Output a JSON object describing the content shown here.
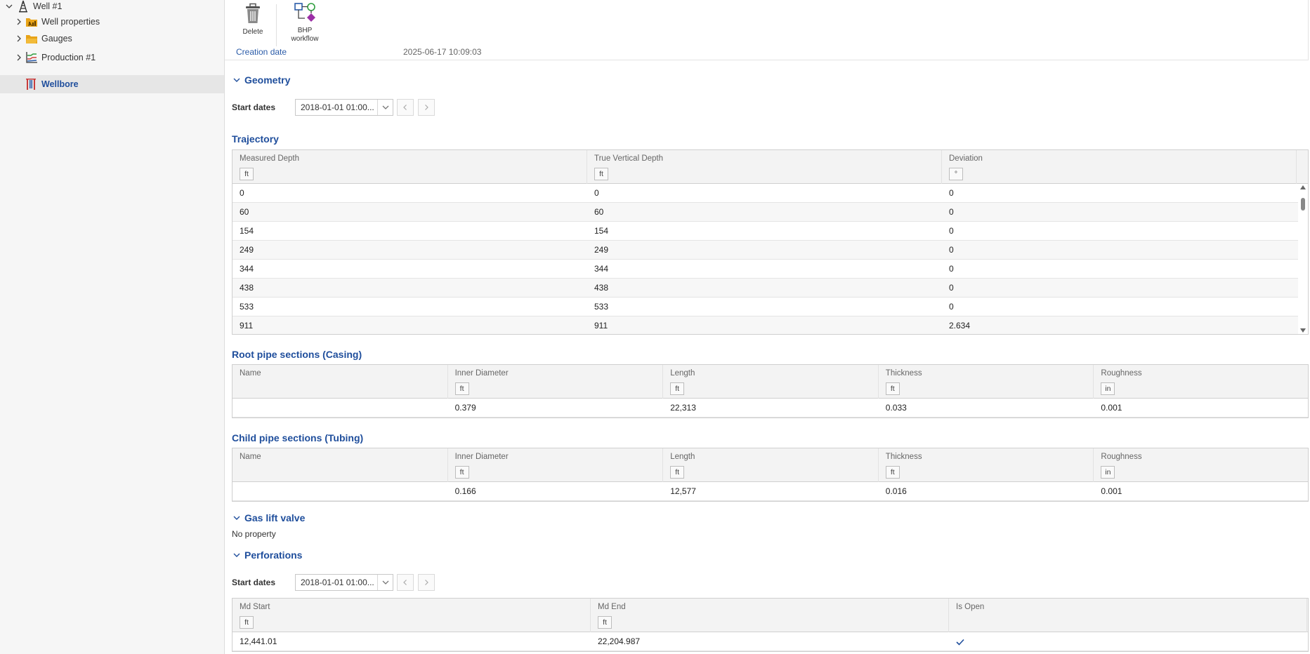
{
  "sidebar": {
    "items": [
      {
        "label": "Well #1",
        "expanded": true,
        "icon": "well-derrick-icon"
      },
      {
        "label": "Well properties",
        "expanded": false,
        "icon": "well-properties-icon"
      },
      {
        "label": "Gauges",
        "expanded": false,
        "icon": "folder-icon"
      },
      {
        "label": "Production #1",
        "expanded": false,
        "icon": "production-chart-icon"
      },
      {
        "label": "Wellbore",
        "selected": true,
        "icon": "wellbore-icon"
      }
    ]
  },
  "toolbar": {
    "delete_label": "Delete",
    "bhp_label_line1": "BHP",
    "bhp_label_line2": "workflow"
  },
  "header": {
    "creation_label": "Creation date",
    "creation_value": "2025-06-17 10:09:03"
  },
  "geometry": {
    "title": "Geometry",
    "start_dates_label": "Start dates",
    "start_date_value": "2018-01-01 01:00..."
  },
  "trajectory": {
    "title": "Trajectory",
    "columns": [
      {
        "label": "Measured Depth",
        "unit": "ft"
      },
      {
        "label": "True Vertical Depth",
        "unit": "ft"
      },
      {
        "label": "Deviation",
        "unit": "°"
      }
    ],
    "rows": [
      [
        "0",
        "0",
        "0"
      ],
      [
        "60",
        "60",
        "0"
      ],
      [
        "154",
        "154",
        "0"
      ],
      [
        "249",
        "249",
        "0"
      ],
      [
        "344",
        "344",
        "0"
      ],
      [
        "438",
        "438",
        "0"
      ],
      [
        "533",
        "533",
        "0"
      ],
      [
        "911",
        "911",
        "2.634"
      ]
    ]
  },
  "casing": {
    "title": "Root pipe sections (Casing)",
    "columns": [
      {
        "label": "Name",
        "unit": ""
      },
      {
        "label": "Inner Diameter",
        "unit": "ft"
      },
      {
        "label": "Length",
        "unit": "ft"
      },
      {
        "label": "Thickness",
        "unit": "ft"
      },
      {
        "label": "Roughness",
        "unit": "in"
      }
    ],
    "rows": [
      [
        "",
        "0.379",
        "22,313",
        "0.033",
        "0.001"
      ]
    ]
  },
  "tubing": {
    "title": "Child pipe sections (Tubing)",
    "columns": [
      {
        "label": "Name",
        "unit": ""
      },
      {
        "label": "Inner Diameter",
        "unit": "ft"
      },
      {
        "label": "Length",
        "unit": "ft"
      },
      {
        "label": "Thickness",
        "unit": "ft"
      },
      {
        "label": "Roughness",
        "unit": "in"
      }
    ],
    "rows": [
      [
        "",
        "0.166",
        "12,577",
        "0.016",
        "0.001"
      ]
    ]
  },
  "gas_lift": {
    "title": "Gas lift valve",
    "empty_text": "No property"
  },
  "perforations": {
    "title": "Perforations",
    "start_dates_label": "Start dates",
    "start_date_value": "2018-01-01 01:00...",
    "columns": [
      {
        "label": "Md Start",
        "unit": "ft"
      },
      {
        "label": "Md End",
        "unit": "ft"
      },
      {
        "label": "Is Open",
        "unit": ""
      }
    ],
    "rows": [
      [
        "12,441.01",
        "22,204.987",
        true
      ]
    ]
  },
  "colors": {
    "accent": "#1f4e9c",
    "selected_bg": "#e6e6e6"
  }
}
